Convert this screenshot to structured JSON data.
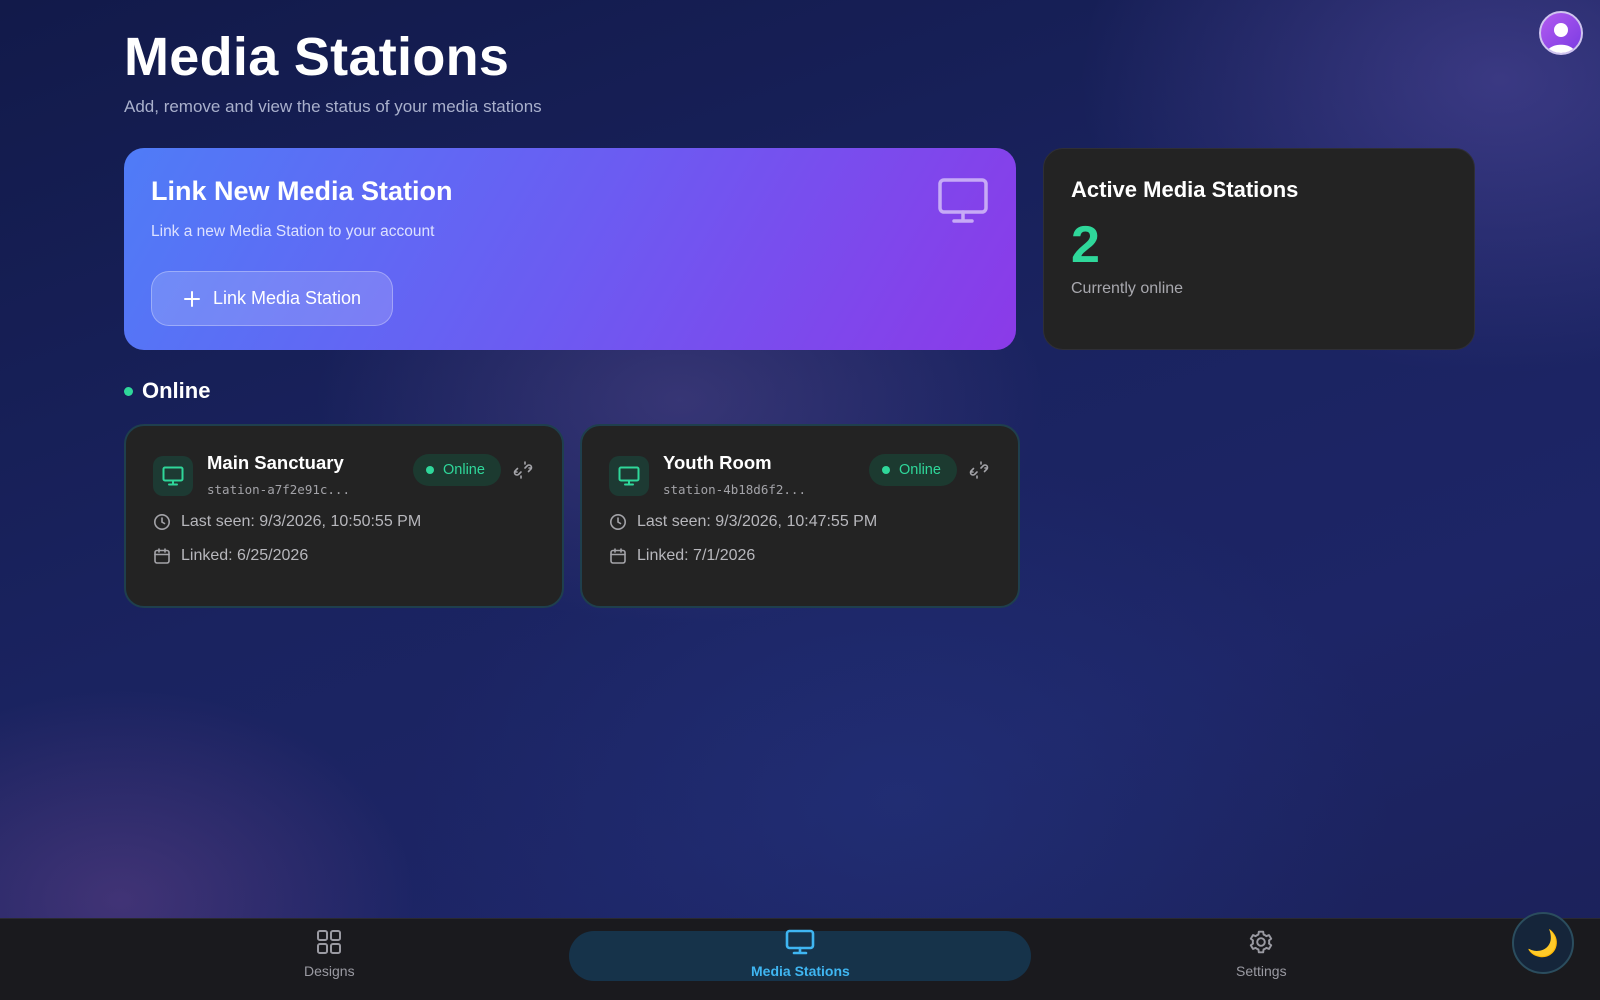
{
  "header": {
    "title": "Media Stations",
    "subtitle": "Add, remove and view the status of your media stations"
  },
  "link_card": {
    "title": "Link New Media Station",
    "description": "Link a new Media Station to your account",
    "button_label": "Link Media Station",
    "icon": "monitor-icon"
  },
  "active_card": {
    "title": "Active Media Stations",
    "count": "2",
    "caption": "Currently online"
  },
  "section": {
    "label": "Online"
  },
  "stations": [
    {
      "name": "Main Sanctuary",
      "id": "station-a7f2e91c...",
      "status": "Online",
      "last_seen": "Last seen: 9/3/2026, 10:50:55 PM",
      "linked": "Linked: 6/25/2026"
    },
    {
      "name": "Youth Room",
      "id": "station-4b18d6f2...",
      "status": "Online",
      "last_seen": "Last seen: 9/3/2026, 10:47:55 PM",
      "linked": "Linked: 7/1/2026"
    }
  ],
  "nav": {
    "designs": "Designs",
    "media_stations": "Media Stations",
    "settings": "Settings",
    "active": "media_stations"
  },
  "theme_toggle": {
    "icon": "moon-icon",
    "glyph": "🌙"
  },
  "colors": {
    "accent": "#3fb6f2",
    "online": "#2fd79a",
    "card_gradient_start": "#4f7cf7",
    "card_gradient_end": "#8b3ae8"
  }
}
